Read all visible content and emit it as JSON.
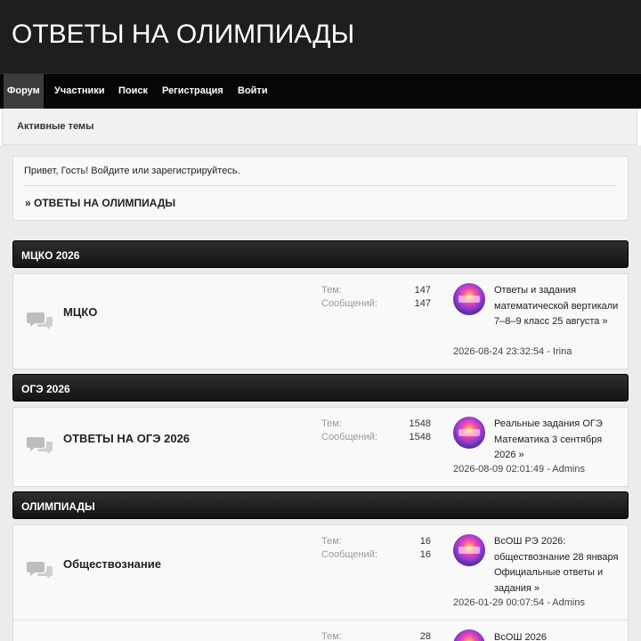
{
  "site": {
    "title": "ОТВЕТЫ НА ОЛИМПИАДЫ"
  },
  "nav": [
    "Форум",
    "Участники",
    "Поиск",
    "Регистрация",
    "Войти"
  ],
  "subnav": {
    "active_topics": "Активные темы"
  },
  "welcome": {
    "text": "Привет, Гость!  Войдите или зарегистрируйтесь.",
    "breadcrumb": "» ОТВЕТЫ НА ОЛИМПИАДЫ"
  },
  "categories": [
    {
      "title": "МЦКО 2026",
      "boards": [
        {
          "name": "МЦКО",
          "topics_label": "Тем:",
          "topics": "147",
          "posts_label": "Сообщений:",
          "posts": "147",
          "last_post_title": "Ответы и задания математической вертикали 7–8–9 класс 25 августа »",
          "last_post_meta": "2026-08-24 23:32:54 - Irina"
        }
      ]
    },
    {
      "title": "ОГЭ 2026",
      "boards": [
        {
          "name": "ОТВЕТЫ НА ОГЭ 2026",
          "topics_label": "Тем:",
          "topics": "1548",
          "posts_label": "Сообщений:",
          "posts": "1548",
          "last_post_title": "Реальные задания ОГЭ Математика 3 сентября 2026 »",
          "last_post_meta": "2026-08-09 02:01:49 - Admins"
        }
      ]
    },
    {
      "title": "ОЛИМПИАДЫ",
      "boards": [
        {
          "name": "Обществознание",
          "topics_label": "Тем:",
          "topics": "16",
          "posts_label": "Сообщений:",
          "posts": "16",
          "last_post_title": "ВсОШ РЭ 2026: обществознание 28 января Официальные ответы и задания »",
          "last_post_meta": "2026-01-29 00:07:54 - Admins"
        },
        {
          "name": "",
          "topics_label": "Тем:",
          "topics": "28",
          "posts_label": "",
          "posts": "",
          "last_post_title": "ВсОШ 2026",
          "last_post_meta": ""
        }
      ]
    }
  ],
  "colors": {
    "header_bg": "#1e1e1e",
    "navbar_bg": "#060606",
    "nav_active_bg": "#3c3c3c",
    "page_bg": "#ececec",
    "panel_bg": "#f9f9f9"
  },
  "icons": {
    "board": "chat-bubbles-icon",
    "avatar": "user-avatar-icon"
  }
}
